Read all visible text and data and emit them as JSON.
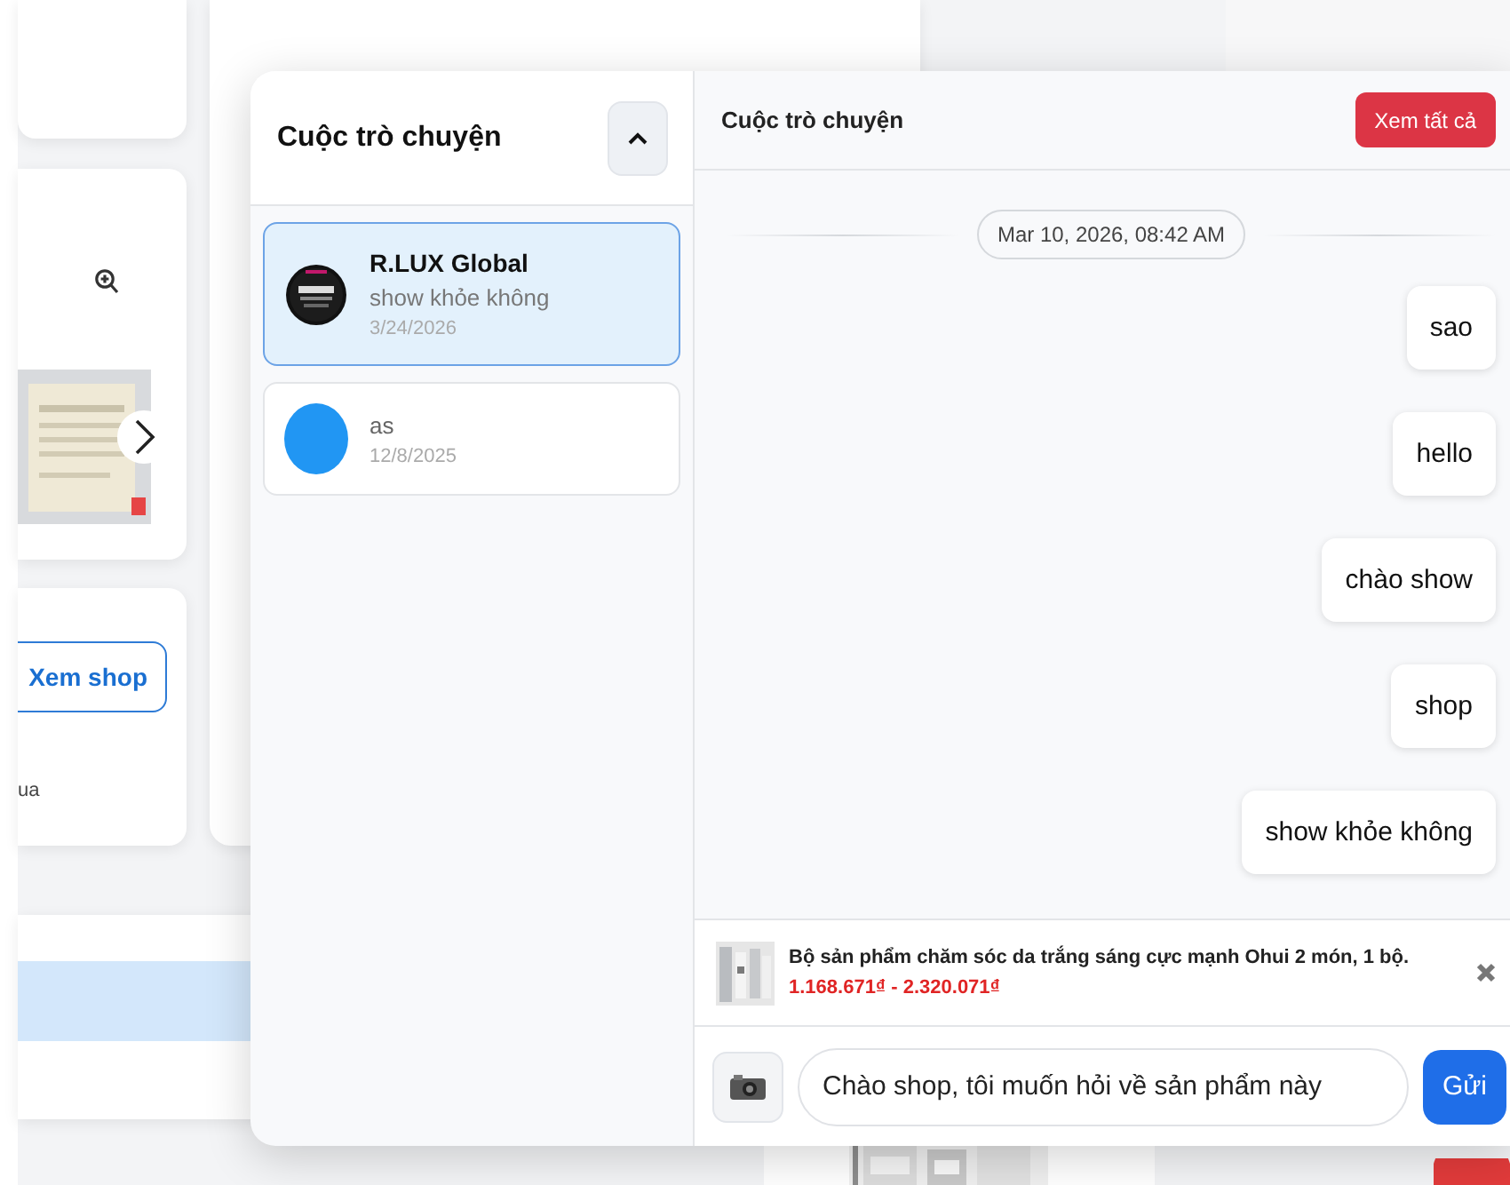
{
  "background": {
    "shop_button": "Xem shop",
    "caption": "ua"
  },
  "chat": {
    "sidebar_title": "Cuộc trò chuyện",
    "conversations": [
      {
        "name": "R.LUX Global",
        "last_message": "show khỏe không",
        "date": "3/24/2026",
        "selected": true
      },
      {
        "name": "as",
        "date": "12/8/2025",
        "avatar": {
          "kind": "plain"
        },
        "selected": false
      }
    ],
    "header_title": "Cuộc trò chuyện",
    "view_all_button": "Xem tất cả",
    "date_chip": "Mar 10, 2026, 08:42 AM",
    "messages": [
      {
        "text": "sao"
      },
      {
        "text": "hello"
      },
      {
        "text": "chào show"
      },
      {
        "text": "shop"
      },
      {
        "text": "show khỏe không"
      }
    ],
    "product": {
      "title": "Bộ sản phẩm chăm sóc da trắng sáng cực mạnh Ohui 2 món, 1 bộ.",
      "price": "1.168.671₫ - 2.320.071₫"
    },
    "composer": {
      "value": "Chào shop, tôi muốn hỏi về sản phẩm này",
      "send_button": "Gửi"
    }
  }
}
